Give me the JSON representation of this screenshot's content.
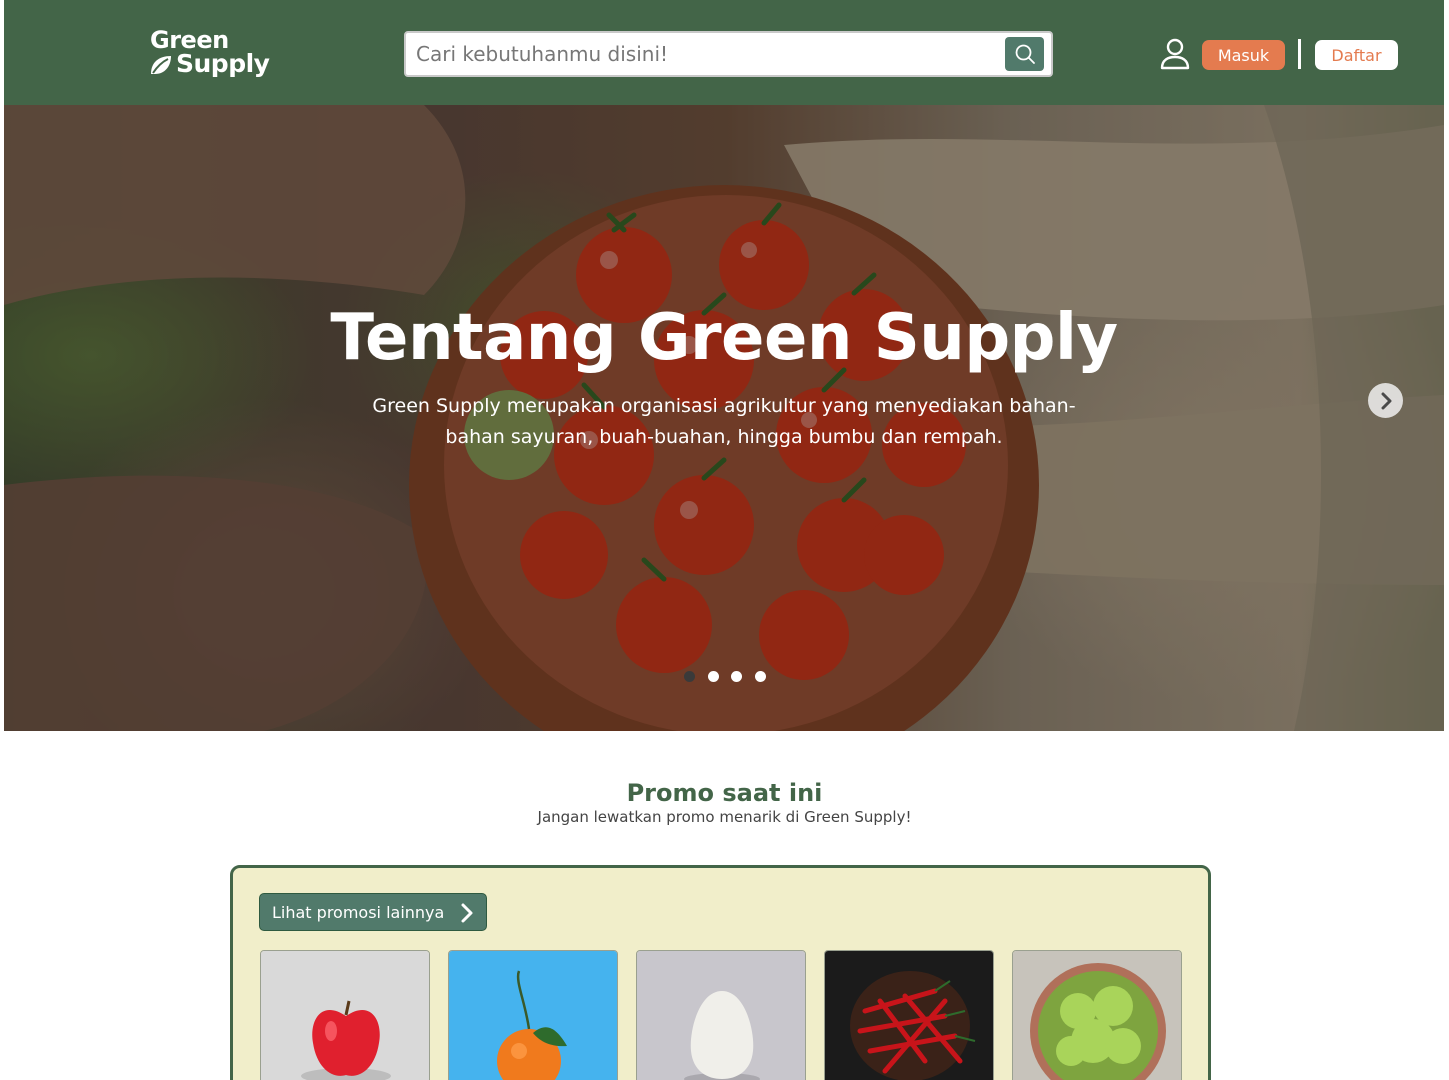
{
  "header": {
    "logo": {
      "line1": "Green",
      "line2": "Supply"
    },
    "search": {
      "placeholder": "Cari kebutuhanmu disini!"
    },
    "login_label": "Masuk",
    "register_label": "Daftar",
    "colors": {
      "primary": "#436548",
      "accent": "#e47b4f",
      "search_button": "#517a6b"
    }
  },
  "hero": {
    "title": "Tentang Green Supply",
    "description": "Green Supply merupakan organisasi agrikultur yang menyediakan bahan-bahan sayuran, buah-buahan, hingga bumbu dan rempah.",
    "slide_count": 4,
    "active_slide": 1
  },
  "promo": {
    "title": "Promo saat ini",
    "subtitle": "Jangan lewatkan promo menarik di Green Supply!",
    "more_label": "Lihat promosi lainnya",
    "box_color": "#f1eeca",
    "items": [
      {
        "icon": "apple-image"
      },
      {
        "icon": "orange-image"
      },
      {
        "icon": "egg-image"
      },
      {
        "icon": "chili-image"
      },
      {
        "icon": "lettuce-image"
      }
    ]
  }
}
